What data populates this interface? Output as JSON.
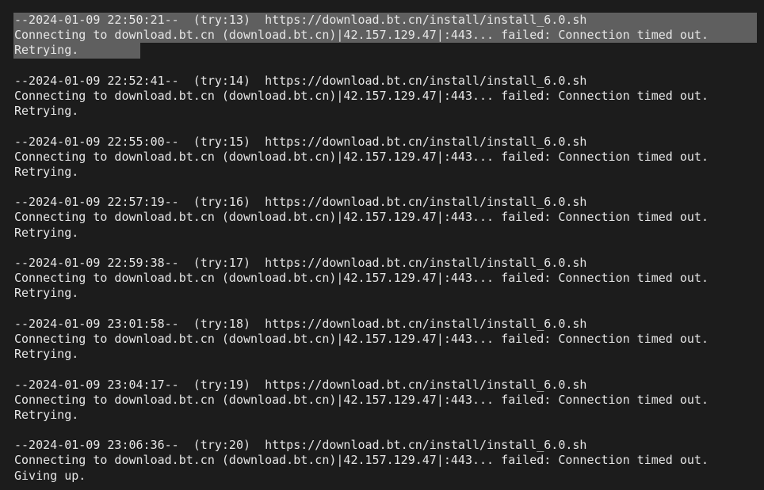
{
  "terminal": {
    "title": "wget retry log",
    "background_color": "#1c1c1c",
    "text_color": "#e6e6e6",
    "selection_color": "#5f5f5f",
    "blocks": [
      {
        "id": "try-13",
        "request_line": "--2024-01-09 22:50:21--  (try:13)  https://download.bt.cn/install/install_6.0.sh",
        "connect_line": "Connecting to download.bt.cn (download.bt.cn)|42.157.129.47|:443... failed: Connection timed out.",
        "status_line": "Retrying.",
        "timestamp": "2024-01-09 22:50:21",
        "try": "13",
        "url": "https://download.bt.cn/install/install_6.0.sh",
        "host": "download.bt.cn",
        "ip": "42.157.129.47",
        "port": "443",
        "error": "Connection timed out.",
        "selected": true
      },
      {
        "id": "try-14",
        "request_line": "--2024-01-09 22:52:41--  (try:14)  https://download.bt.cn/install/install_6.0.sh",
        "connect_line": "Connecting to download.bt.cn (download.bt.cn)|42.157.129.47|:443... failed: Connection timed out.",
        "status_line": "Retrying.",
        "timestamp": "2024-01-09 22:52:41",
        "try": "14",
        "url": "https://download.bt.cn/install/install_6.0.sh",
        "host": "download.bt.cn",
        "ip": "42.157.129.47",
        "port": "443",
        "error": "Connection timed out.",
        "selected": false
      },
      {
        "id": "try-15",
        "request_line": "--2024-01-09 22:55:00--  (try:15)  https://download.bt.cn/install/install_6.0.sh",
        "connect_line": "Connecting to download.bt.cn (download.bt.cn)|42.157.129.47|:443... failed: Connection timed out.",
        "status_line": "Retrying.",
        "timestamp": "2024-01-09 22:55:00",
        "try": "15",
        "url": "https://download.bt.cn/install/install_6.0.sh",
        "host": "download.bt.cn",
        "ip": "42.157.129.47",
        "port": "443",
        "error": "Connection timed out.",
        "selected": false
      },
      {
        "id": "try-16",
        "request_line": "--2024-01-09 22:57:19--  (try:16)  https://download.bt.cn/install/install_6.0.sh",
        "connect_line": "Connecting to download.bt.cn (download.bt.cn)|42.157.129.47|:443... failed: Connection timed out.",
        "status_line": "Retrying.",
        "timestamp": "2024-01-09 22:57:19",
        "try": "16",
        "url": "https://download.bt.cn/install/install_6.0.sh",
        "host": "download.bt.cn",
        "ip": "42.157.129.47",
        "port": "443",
        "error": "Connection timed out.",
        "selected": false
      },
      {
        "id": "try-17",
        "request_line": "--2024-01-09 22:59:38--  (try:17)  https://download.bt.cn/install/install_6.0.sh",
        "connect_line": "Connecting to download.bt.cn (download.bt.cn)|42.157.129.47|:443... failed: Connection timed out.",
        "status_line": "Retrying.",
        "timestamp": "2024-01-09 22:59:38",
        "try": "17",
        "url": "https://download.bt.cn/install/install_6.0.sh",
        "host": "download.bt.cn",
        "ip": "42.157.129.47",
        "port": "443",
        "error": "Connection timed out.",
        "selected": false
      },
      {
        "id": "try-18",
        "request_line": "--2024-01-09 23:01:58--  (try:18)  https://download.bt.cn/install/install_6.0.sh",
        "connect_line": "Connecting to download.bt.cn (download.bt.cn)|42.157.129.47|:443... failed: Connection timed out.",
        "status_line": "Retrying.",
        "timestamp": "2024-01-09 23:01:58",
        "try": "18",
        "url": "https://download.bt.cn/install/install_6.0.sh",
        "host": "download.bt.cn",
        "ip": "42.157.129.47",
        "port": "443",
        "error": "Connection timed out.",
        "selected": false
      },
      {
        "id": "try-19",
        "request_line": "--2024-01-09 23:04:17--  (try:19)  https://download.bt.cn/install/install_6.0.sh",
        "connect_line": "Connecting to download.bt.cn (download.bt.cn)|42.157.129.47|:443... failed: Connection timed out.",
        "status_line": "Retrying.",
        "timestamp": "2024-01-09 23:04:17",
        "try": "19",
        "url": "https://download.bt.cn/install/install_6.0.sh",
        "host": "download.bt.cn",
        "ip": "42.157.129.47",
        "port": "443",
        "error": "Connection timed out.",
        "selected": false
      },
      {
        "id": "try-20",
        "request_line": "--2024-01-09 23:06:36--  (try:20)  https://download.bt.cn/install/install_6.0.sh",
        "connect_line": "Connecting to download.bt.cn (download.bt.cn)|42.157.129.47|:443... failed: Connection timed out.",
        "status_line": "Giving up.",
        "timestamp": "2024-01-09 23:06:36",
        "try": "20",
        "url": "https://download.bt.cn/install/install_6.0.sh",
        "host": "download.bt.cn",
        "ip": "42.157.129.47",
        "port": "443",
        "error": "Connection timed out.",
        "selected": false
      }
    ]
  }
}
